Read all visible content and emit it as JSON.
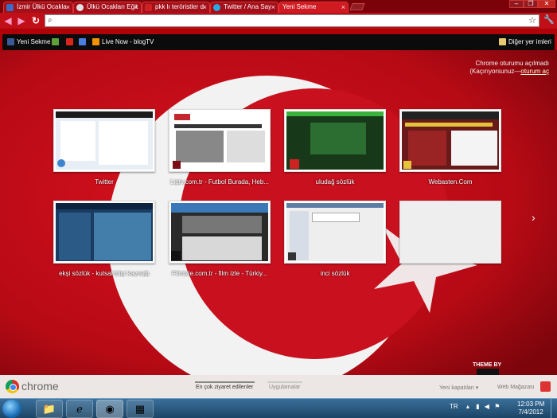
{
  "tabs": [
    {
      "title": "İzmir Ülkü Ocakla",
      "favicon_color": "#3b6cc4"
    },
    {
      "title": "Ülkü Ocakları Eğit",
      "favicon_color": "#e3e3e3"
    },
    {
      "title": "pkk lı teröristler d",
      "favicon_color": "#c22"
    },
    {
      "title": "Twitter / Ana Say",
      "favicon_color": "#2aa9e0"
    },
    {
      "title": "Yeni Sekme",
      "favicon_color": "#ffffff"
    }
  ],
  "omnibox": {
    "value": ""
  },
  "bookmarks": {
    "items": [
      {
        "label": "Yeni Sekme",
        "icon": "facebook-icon",
        "color": "#3b5998"
      },
      {
        "label": "",
        "icon": "green-square-icon",
        "color": "#5da13b"
      },
      {
        "label": "",
        "icon": "u-icon",
        "color": "#d8261c"
      },
      {
        "label": "",
        "icon": "google-icon",
        "color": "#4b7fdd"
      },
      {
        "label": "Live Now - blogTV",
        "icon": "rss-icon",
        "color": "#f29200"
      }
    ],
    "other": "Diğer yer imleri"
  },
  "sync": {
    "line1": "Chrome oturumu açılmadı",
    "line2_prefix": "(Kaçırıyorsunuz—",
    "line2_link": "oturum aç"
  },
  "thumbnails": [
    {
      "label": "Twitter",
      "bg": "#e8eef6",
      "accent": "#3c86cf"
    },
    {
      "label": "Ligtv.com.tr - Futbol Burada, Heb...",
      "bg": "#ffffff",
      "accent": "#c2272d"
    },
    {
      "label": "uludağ sözlük",
      "bg": "#17391a",
      "accent": "#3bb23c"
    },
    {
      "label": "Webasten.Com",
      "bg": "#6b1a1a",
      "accent": "#e7c33b"
    },
    {
      "label": "ekşi sözlük - kutsal bilgi kaynağı",
      "bg": "#1a3c63",
      "accent": "#5fa8d9"
    },
    {
      "label": "Filmizle.com.tr - film izle - Türkiy...",
      "bg": "#2a2a2a",
      "accent": "#3b78b8"
    },
    {
      "label": "inci sözlük",
      "bg": "#eeeeee",
      "accent": "#5e7ea6"
    },
    {
      "label": "",
      "bg": "#eeeeee",
      "accent": "#eeeeee"
    }
  ],
  "ntp": {
    "brand": "chrome",
    "tab1": "En çok ziyaret edilenler",
    "tab2": "Uygulamalar",
    "recently_closed": "Yeni kapatılan",
    "web_store": "Web Mağazası",
    "theme_by": "THEME BY"
  },
  "taskbar": {
    "tray_lang": "TR",
    "time": "12:03 PM",
    "date": "7/4/2012"
  },
  "colors": {
    "flag_red": "#c8101e",
    "crescent": "#ffffff"
  }
}
